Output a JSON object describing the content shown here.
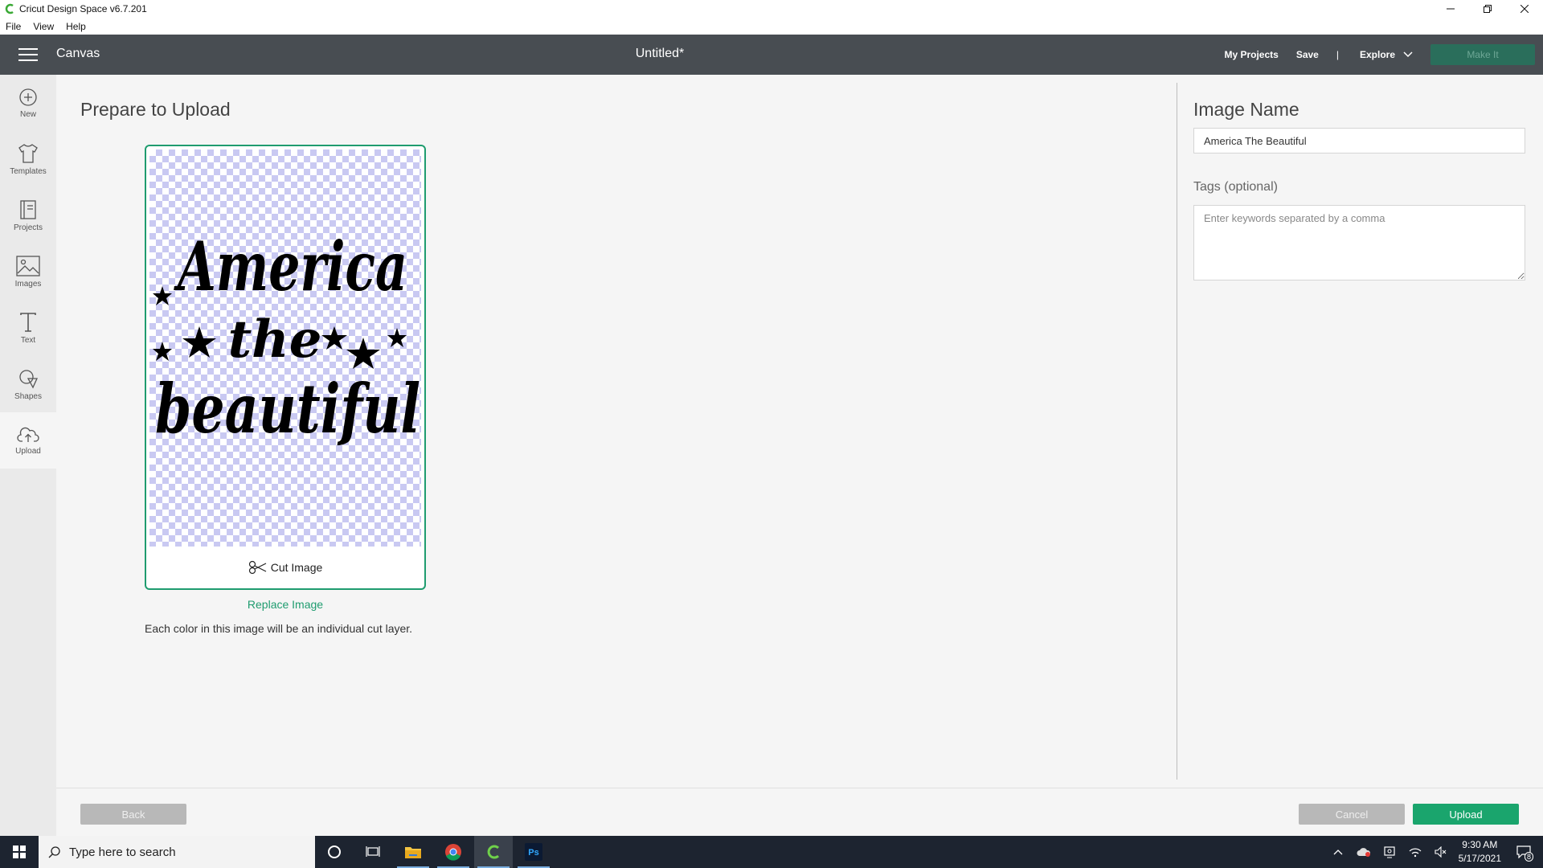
{
  "window": {
    "title": "Cricut Design Space  v6.7.201"
  },
  "menu": [
    "File",
    "View",
    "Help"
  ],
  "header": {
    "canvas_label": "Canvas",
    "doc_title": "Untitled*",
    "my_projects": "My Projects",
    "save": "Save",
    "separator": "|",
    "explore": "Explore",
    "make_it": "Make It"
  },
  "sidebar": {
    "items": [
      {
        "label": "New",
        "icon": "plus-circle-icon"
      },
      {
        "label": "Templates",
        "icon": "shirt-icon"
      },
      {
        "label": "Projects",
        "icon": "projects-icon"
      },
      {
        "label": "Images",
        "icon": "image-icon"
      },
      {
        "label": "Text",
        "icon": "text-icon"
      },
      {
        "label": "Shapes",
        "icon": "shapes-icon"
      },
      {
        "label": "Upload",
        "icon": "cloud-upload-icon"
      }
    ]
  },
  "main": {
    "title": "Prepare to Upload",
    "image_lines": [
      "America",
      "the",
      "beautiful"
    ],
    "cut_image": "Cut Image",
    "replace_image": "Replace Image",
    "note": "Each color in this image will be an individual cut layer."
  },
  "right": {
    "image_name_label": "Image Name",
    "image_name_value": "America The Beautiful",
    "tags_label": "Tags (optional)",
    "tags_placeholder": "Enter keywords separated by a comma"
  },
  "footer": {
    "back": "Back",
    "cancel": "Cancel",
    "upload": "Upload"
  },
  "taskbar": {
    "search_placeholder": "Type here to search",
    "time": "9:30 AM",
    "date": "5/17/2021",
    "notification_count": "8",
    "ps_label": "Ps"
  },
  "colors": {
    "header_bg": "#484d52",
    "accent": "#1aa56d",
    "checker": "#c9c9f2"
  }
}
